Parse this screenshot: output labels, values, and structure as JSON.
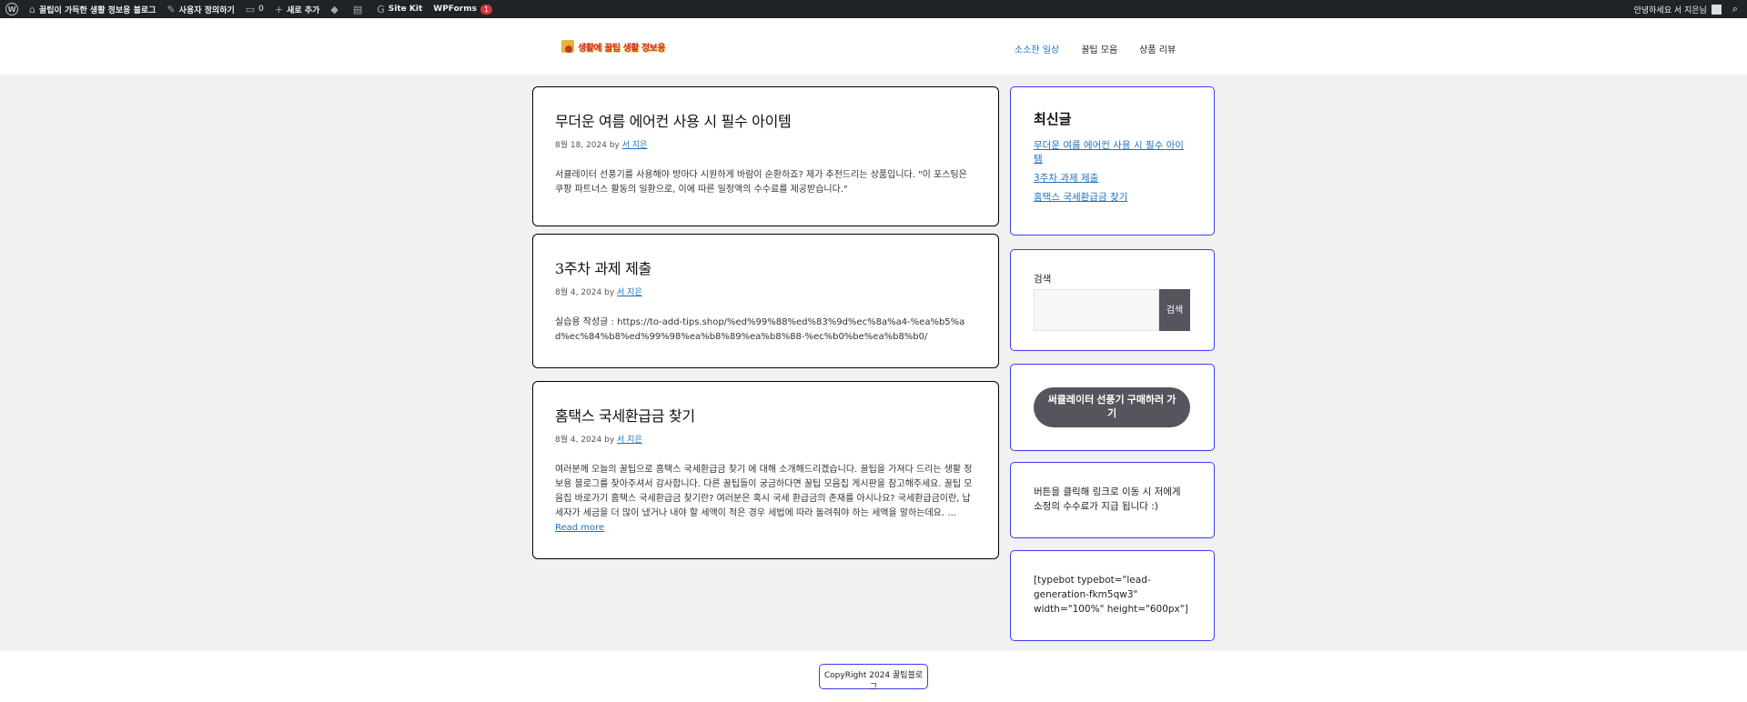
{
  "adminbar": {
    "site_name": "꿀팁이 가득한 생활 정보용 블로그",
    "customize": "사용자 정의하기",
    "comments_count": "0",
    "new": "새로 추가",
    "sitekit": "Site Kit",
    "wpforms": "WPForms",
    "wpforms_badge": "1",
    "greeting": "안녕하세요 서 지은님"
  },
  "header": {
    "logo_text": "생활에 꿀팁 생활 정보용",
    "nav": [
      "소소한 일상",
      "꿀팁 모음",
      "상품 리뷰"
    ]
  },
  "posts": [
    {
      "title": "무더운 여름 에어컨 사용 시 필수 아이템",
      "date": "8월 18, 2024",
      "by": "by",
      "author": "서 지은",
      "excerpt": "서큘레이터 선풍기를 사용해야 방마다 시원하게 바람이 순환하죠? 제가 추천드리는 상품입니다. \"이 포스팅은 쿠팡 파트너스 활동의 일환으로, 이에 따른 일정액의 수수료를 제공받습니다.\""
    },
    {
      "title": "3주차 과제 제출",
      "date": "8월 4, 2024",
      "by": "by",
      "author": "서 지은",
      "excerpt": "실습용 작성글 : https://to-add-tips.shop/%ed%99%88%ed%83%9d%ec%8a%a4-%ea%b5%ad%ec%84%b8%ed%99%98%ea%b8%89%ea%b8%88-%ec%b0%be%ea%b8%b0/"
    },
    {
      "title": "홈택스 국세환급금 찾기",
      "date": "8월 4, 2024",
      "by": "by",
      "author": "서 지은",
      "excerpt": "여러분께 오늘의 꿀팁으로 홈택스 국세환급금 찾기 에 대해 소개해드리겠습니다. 꿀팁을 가져다 드리는 생활 정보용 블로그를 찾아주셔서 감사합니다. 다른 꿀팁들이 궁금하다면 꿀팁 모음집 게시판을 참고해주세요. 꿀팁 모음집 바로가기 홈택스 국세환급금 찾기란? 여러분은 혹시 국세 환급금의 존재를 아시나요? 국세환급금이란, 납세자가 세금을 더 많이 냈거나 내야 할 세액이 적은 경우 세법에 따라 돌려줘야 하는 세액을 말하는데요. …",
      "read_more": "Read more"
    }
  ],
  "sidebar": {
    "recent_title": "최신글",
    "recent_posts": [
      "무더운 여름 에어컨 사용 시 필수 아이템",
      "3주차 과제 제출",
      "홈택스 국세환급금 찾기"
    ],
    "search_label": "검색",
    "search_button": "검색",
    "cta_button": "써큘레이터 선풍기 구매하러 가기",
    "notice": "버튼을 클릭해 링크로 이동 시 저에게 소정의 수수료가 지급 됩니다 :)",
    "shortcode": "[typebot typebot=\"lead-generation-fkm5qw3\" width=\"100%\" height=\"600px\"]"
  },
  "footer": {
    "copyright": "CopyRight 2024 꿀팁블로그"
  }
}
